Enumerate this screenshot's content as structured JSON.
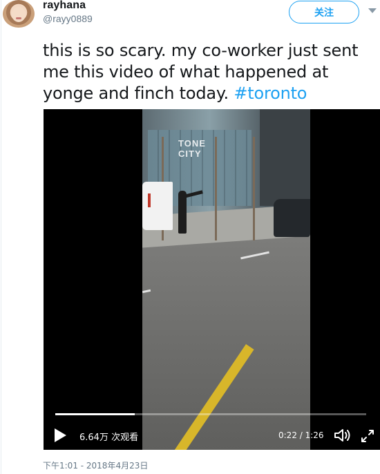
{
  "author": {
    "display_name": "rayhana",
    "handle": "@rayy0889",
    "avatar_icon": "user-avatar"
  },
  "follow_button": {
    "label": "关注"
  },
  "tweet": {
    "text": "this is so scary. my co-worker just sent me this video of what happened at yonge and finch today. ",
    "hashtag": "#toronto"
  },
  "video": {
    "frame_sign": "TONE CITY",
    "views": "6.64万 次观看",
    "time": "0:22 / 1:26",
    "progress_fraction": 0.256,
    "play_icon": "play-icon",
    "volume_icon": "volume-icon",
    "fullscreen_icon": "fullscreen-icon"
  },
  "timestamp": "下午1:01 - 2018年4月23日",
  "colors": {
    "accent": "#1da1f2",
    "text": "#14171a",
    "muted": "#657786"
  }
}
